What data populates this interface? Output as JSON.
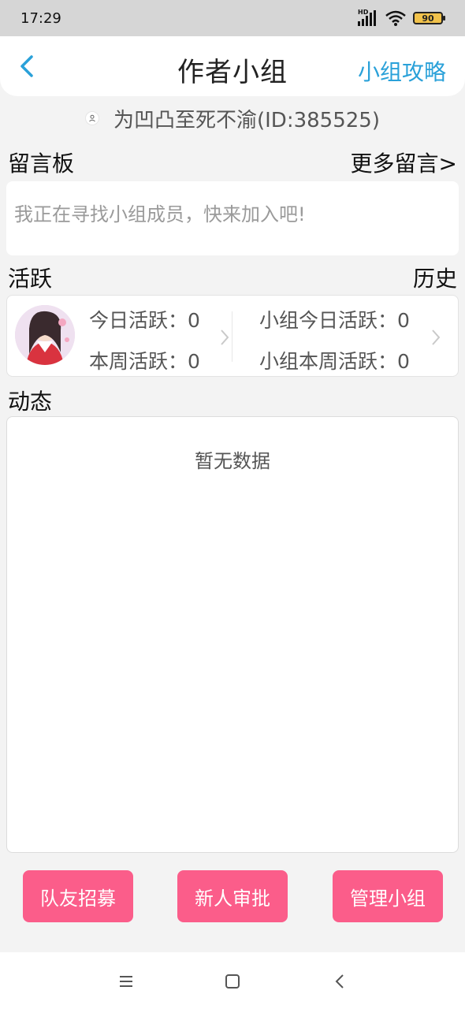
{
  "status_bar": {
    "time": "17:29",
    "hd_label": "HD",
    "battery_level": "90"
  },
  "header": {
    "title": "作者小组",
    "guide_link": "小组攻略",
    "back_icon": "chevron-left-icon",
    "accent_color": "#2aa1d9"
  },
  "owner": {
    "text": "为凹凸至死不渝(ID:385525)"
  },
  "message_board": {
    "title": "留言板",
    "more_link": "更多留言>",
    "placeholder": "我正在寻找小组成员，快来加入吧!"
  },
  "activity": {
    "title": "活跃",
    "history_link": "历史",
    "today_label": "今日活跃：0",
    "week_label": "本周活跃：0",
    "group_today_label": "小组今日活跃：0",
    "group_week_label": "小组本周活跃：0"
  },
  "feed": {
    "title": "动态",
    "empty_text": "暂无数据"
  },
  "actions": {
    "recruit_label": "队友招募",
    "approve_label": "新人审批",
    "manage_label": "管理小组",
    "button_color": "#fb5d8a"
  },
  "nav": {
    "menu_icon": "menu-icon",
    "home_icon": "home-square-icon",
    "back_icon": "back-chevron-icon"
  }
}
